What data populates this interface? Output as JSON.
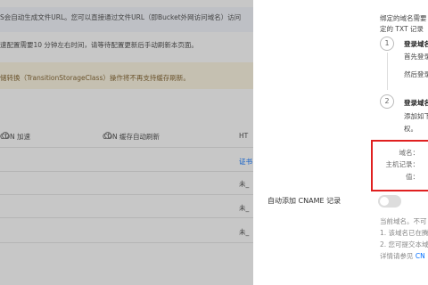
{
  "background_page": {
    "notice_lines": [
      "S会自动生成文件URL。您可以直接通过文件URL（即Bucket外网访问域名）访问",
      "速配置需要10 分钟左右时间，请等待配置更新后手动刷新本页面。"
    ],
    "warning_text": "储转换（TransitionStorageClass）操作将不再支持缓存刷新。",
    "table_headers": {
      "cdn_accel": "CDN 加速",
      "cdn_cache_refresh": "CDN 缓存自动刷新",
      "https": "HT"
    },
    "cells": {
      "cert": "证书",
      "status1": "未_",
      "status2": "未_",
      "status3": "未_"
    }
  },
  "drawer": {
    "intro_lines": [
      "绑定的域名需要",
      "定的 TXT 记录"
    ],
    "steps": [
      {
        "num": "1",
        "title": "登录域名",
        "lines": [
          "首先登录",
          "然后登录"
        ]
      },
      {
        "num": "2",
        "title": "登录域名",
        "lines": [
          "添加如下",
          "权。"
        ]
      }
    ],
    "record_labels": {
      "domain": "域名：",
      "host": "主机记录：",
      "value": "值："
    },
    "auto_cname_label": "自动添加 CNAME 记录",
    "auto_cname_enabled": false,
    "notes": [
      "当前域名。不可",
      "1. 该域名已在腾",
      "2. 您可提交本域",
      "详情请参见 "
    ],
    "link_text": "CN",
    "colors": {
      "accent": "#006eff",
      "red_box": "#e02020",
      "warning_bg": "#fdf6e3"
    }
  }
}
